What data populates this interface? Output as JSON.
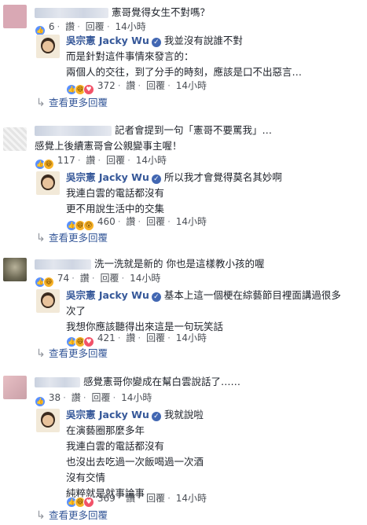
{
  "threads": [
    {
      "comment": {
        "text": "憲哥覺得女生不對嗎？",
        "reactions": [
          "like"
        ],
        "count": "6",
        "actions": [
          "讚",
          "回覆"
        ],
        "time": "14小時"
      },
      "reply": {
        "name": "吳宗憲 Jacky Wu",
        "lines": [
          "我並沒有說誰不對",
          "而是針對這件事情來發言的：",
          "兩個人的交往，到了分手的時刻，應該是口不出惡言…"
        ],
        "reactions": [
          "like",
          "haha",
          "love"
        ],
        "count": "372",
        "actions": [
          "讚",
          "回覆"
        ],
        "time": "14小時"
      },
      "more_replies": "查看更多回覆"
    },
    {
      "comment": {
        "text": "記者會提到一句「憲哥不要罵我」…",
        "lines": [
          "感覺上後續憲哥會公親變事主喔！"
        ],
        "reactions": [
          "like",
          "haha"
        ],
        "count": "117",
        "actions": [
          "讚",
          "回覆"
        ],
        "time": "14小時"
      },
      "reply": {
        "name": "吳宗憲 Jacky Wu",
        "lines": [
          "所以我才會覺得莫名其妙啊",
          "我連白雲的電話都沒有",
          "更不用說生活中的交集"
        ],
        "reactions": [
          "like",
          "haha",
          "wow"
        ],
        "count": "460",
        "actions": [
          "讚",
          "回覆"
        ],
        "time": "14小時"
      },
      "more_replies": "查看更多回覆"
    },
    {
      "comment": {
        "text": "洗一洗就是新的 你也是這樣教小孩的喔",
        "reactions": [
          "like",
          "haha"
        ],
        "count": "74",
        "actions": [
          "讚",
          "回覆"
        ],
        "time": "14小時"
      },
      "reply": {
        "name": "吳宗憲 Jacky Wu",
        "lines": [
          "基本上這一個梗在綜藝節目裡面講過很多",
          "次了",
          "我想你應該聽得出來這是一句玩笑話"
        ],
        "reactions": [
          "like",
          "haha",
          "love"
        ],
        "count": "421",
        "actions": [
          "讚",
          "回覆"
        ],
        "time": "14小時"
      },
      "more_replies": "查看更多回覆"
    },
    {
      "comment": {
        "text": "感覺憲哥你變成在幫白雲說話了……",
        "reactions": [
          "like"
        ],
        "count": "38",
        "actions": [
          "讚",
          "回覆"
        ],
        "time": "14小時"
      },
      "reply": {
        "name": "吳宗憲 Jacky Wu",
        "lines": [
          "我就說啦",
          "在演藝圈那麼多年",
          "我連白雲的電話都沒有",
          "也沒出去吃過一次飯喝過一次酒",
          "沒有交情",
          "純粹就是就事論事"
        ],
        "reactions": [
          "like",
          "haha",
          "love"
        ],
        "count": "369",
        "actions": [
          "讚",
          "回覆"
        ],
        "time": "14小時"
      },
      "more_replies": "查看更多回覆"
    }
  ]
}
